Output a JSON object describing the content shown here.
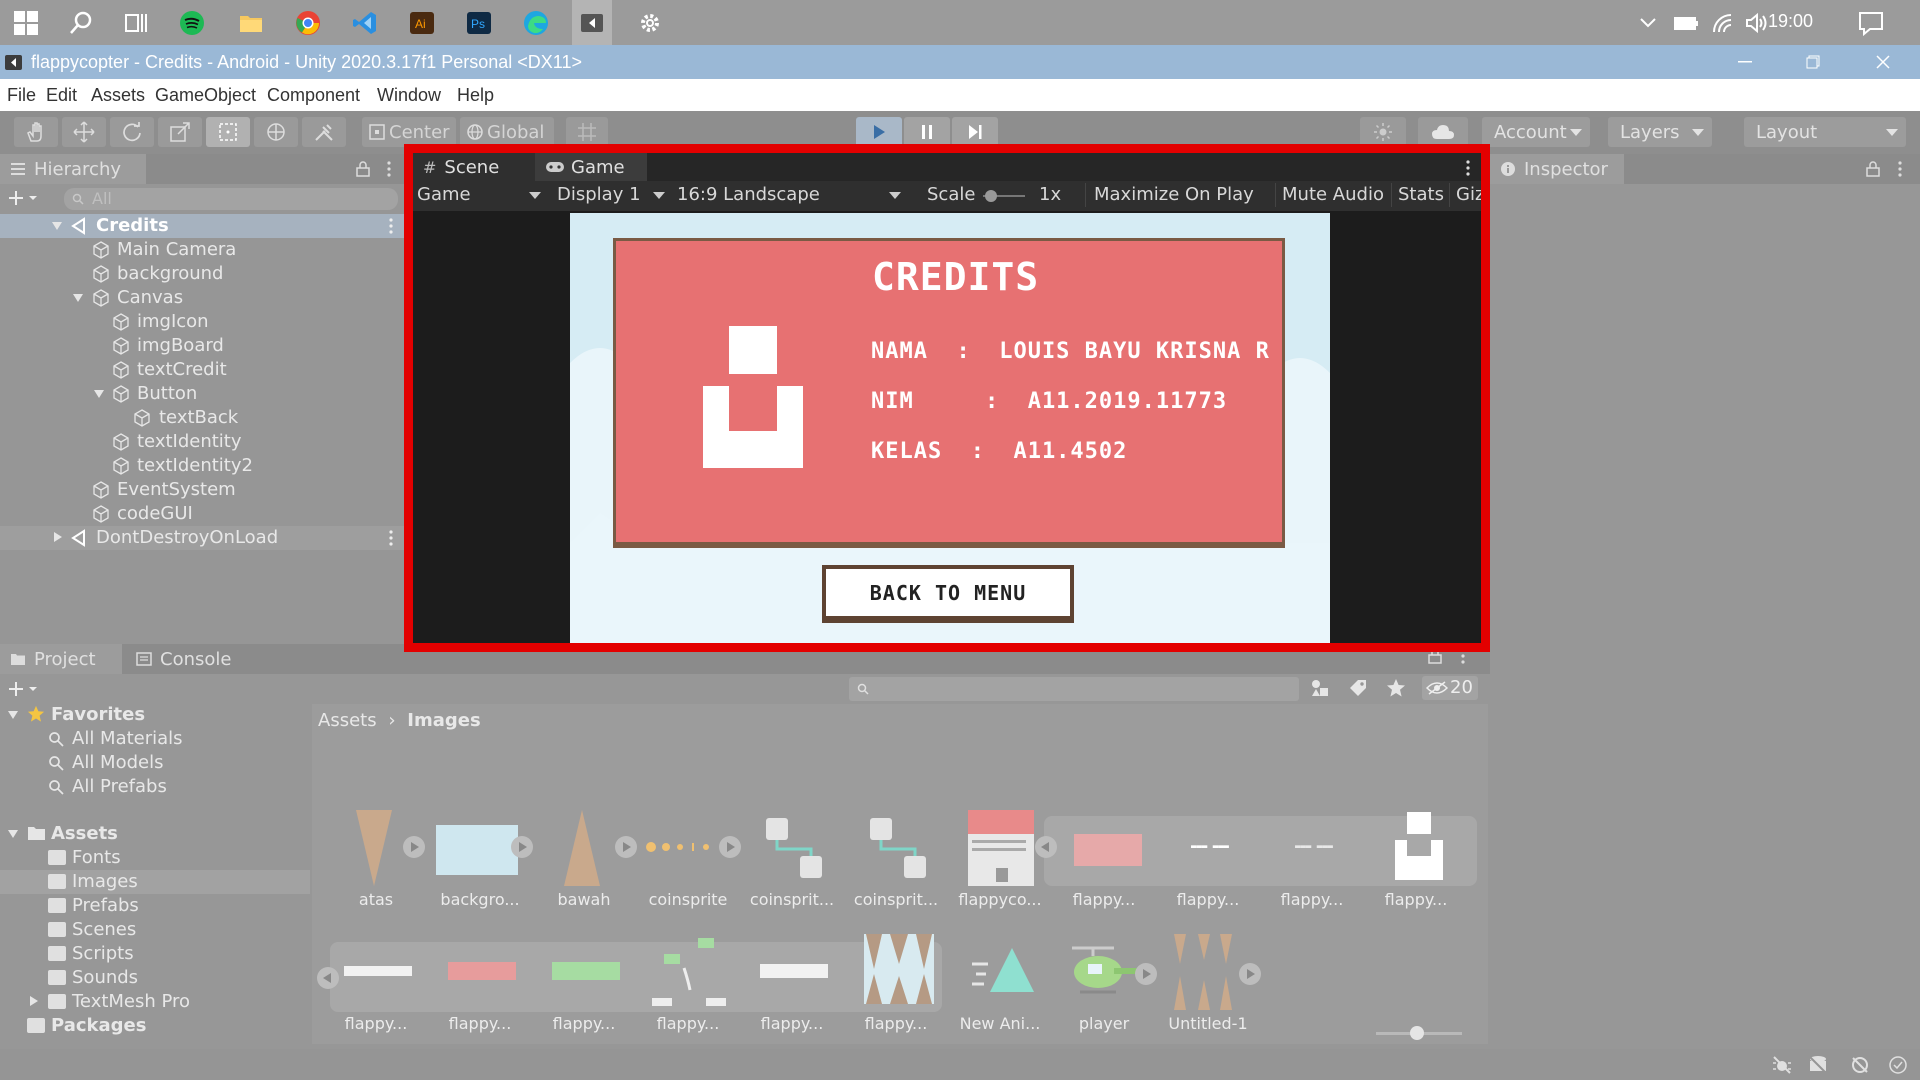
{
  "taskbar": {
    "clock": "19:00",
    "icons": [
      "windows-icon",
      "search-icon",
      "task-view-icon",
      "spotify-icon",
      "file-explorer-icon",
      "chrome-icon",
      "vscode-icon",
      "illustrator-icon",
      "photoshop-icon",
      "edge-icon",
      "unity-icon",
      "settings-icon"
    ]
  },
  "window": {
    "title": "flappycopter - Credits - Android - Unity 2020.3.17f1 Personal <DX11>"
  },
  "menu": [
    "File",
    "Edit",
    "Assets",
    "GameObject",
    "Component",
    "Window",
    "Help"
  ],
  "toolbar": {
    "pivot": "Center",
    "space": "Global",
    "account": "Account",
    "layers": "Layers",
    "layout": "Layout"
  },
  "hierarchy": {
    "title": "Hierarchy",
    "search_placeholder": "All",
    "rows": [
      {
        "label": "Credits",
        "type": "scene"
      },
      {
        "label": "Main Camera"
      },
      {
        "label": "background"
      },
      {
        "label": "Canvas"
      },
      {
        "label": "imgIcon"
      },
      {
        "label": "imgBoard"
      },
      {
        "label": "textCredit"
      },
      {
        "label": "Button"
      },
      {
        "label": "textBack"
      },
      {
        "label": "textIdentity"
      },
      {
        "label": "textIdentity2"
      },
      {
        "label": "EventSystem"
      },
      {
        "label": "codeGUI"
      },
      {
        "label": "DontDestroyOnLoad",
        "type": "scene"
      }
    ]
  },
  "game_view": {
    "tabs": {
      "scene": "Scene",
      "game": "Game"
    },
    "toolbar": {
      "mode": "Game",
      "display": "Display 1",
      "aspect": "16:9 Landscape",
      "scale_label": "Scale",
      "scale_value": "1x",
      "maximize": "Maximize On Play",
      "mute": "Mute Audio",
      "stats": "Stats",
      "gizmos": "Giz"
    },
    "screen": {
      "heading": "CREDITS",
      "nama": "NAMA  :  LOUIS BAYU KRISNA R",
      "nim": "NIM     :  A11.2019.11773",
      "kelas": "KELAS  :  A11.4502",
      "back_button": "BACK TO MENU"
    }
  },
  "inspector": {
    "title": "Inspector"
  },
  "project": {
    "tabs": {
      "project": "Project",
      "console": "Console"
    },
    "hidden_count": "20",
    "favorites": {
      "label": "Favorites",
      "items": [
        "All Materials",
        "All Models",
        "All Prefabs"
      ]
    },
    "assets": {
      "label": "Assets",
      "folders": [
        "Fonts",
        "Images",
        "Prefabs",
        "Scenes",
        "Scripts",
        "Sounds",
        "TextMesh Pro"
      ]
    },
    "packages": "Packages",
    "breadcrumb": {
      "root": "Assets",
      "current": "Images"
    },
    "items_row1": [
      "atas",
      "backgro...",
      "bawah",
      "coinsprite",
      "coinsprit...",
      "coinsprit...",
      "flappyco...",
      "flappy...",
      "flappy...",
      "flappy...",
      "flappy..."
    ],
    "items_row2": [
      "flappy...",
      "flappy...",
      "flappy...",
      "flappy...",
      "flappy...",
      "flappy...",
      "New Ani...",
      "player",
      "Untitled-1"
    ]
  }
}
